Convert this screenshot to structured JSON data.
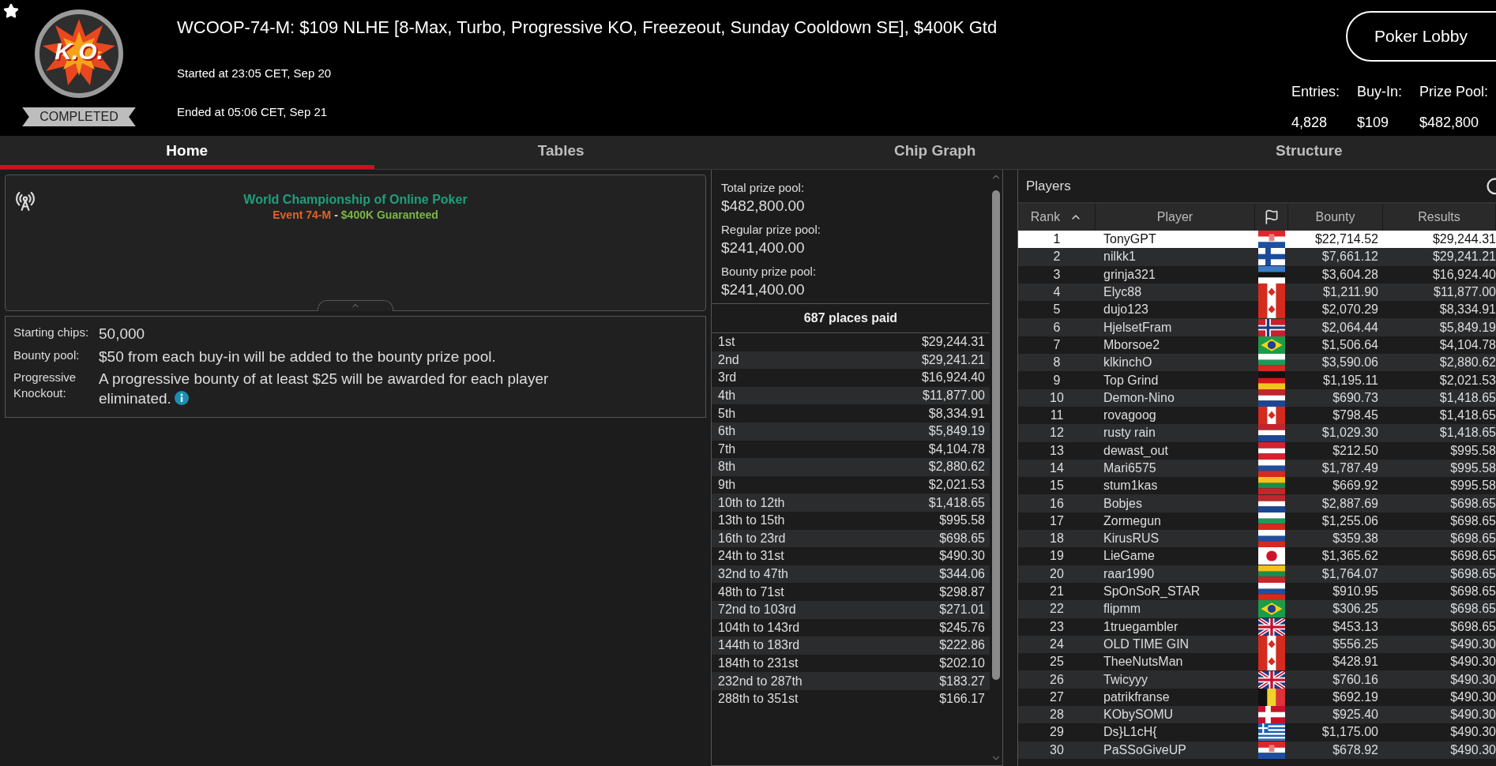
{
  "header": {
    "logo_text": "K.O.",
    "status": "COMPLETED",
    "title": "WCOOP-74-M: $109 NLHE [8-Max, Turbo, Progressive KO, Freezeout, Sunday Cooldown SE], $400K Gtd",
    "started": "Started at 23:05 CET, Sep 20",
    "ended": "Ended at 05:06 CET, Sep 21",
    "lobby_button": "Poker Lobby",
    "stats": [
      {
        "label": "Entries:",
        "value": "4,828"
      },
      {
        "label": "Buy-In:",
        "value": "$109"
      },
      {
        "label": "Prize Pool:",
        "value": "$482,800"
      }
    ]
  },
  "tabs": [
    {
      "label": "Home",
      "selected": true
    },
    {
      "label": "Tables",
      "selected": false
    },
    {
      "label": "Chip Graph",
      "selected": false
    },
    {
      "label": "Structure",
      "selected": false
    }
  ],
  "banner": {
    "title": "World Championship of Online Poker",
    "event": "Event 74-M",
    "separator": "-",
    "guarantee": "$400K Guaranteed"
  },
  "details": [
    {
      "label": "Starting chips:",
      "value": "50,000",
      "info": false
    },
    {
      "label": "Bounty pool:",
      "value": "$50 from each buy-in will be added to the bounty prize pool.",
      "info": false
    },
    {
      "label": "Progressive Knockout:",
      "value": "A progressive bounty of at least $25 will be awarded for each player eliminated.",
      "info": true
    }
  ],
  "prize_summary": [
    {
      "label": "Total prize pool:",
      "value": "$482,800.00"
    },
    {
      "label": "Regular prize pool:",
      "value": "$241,400.00"
    },
    {
      "label": "Bounty prize pool:",
      "value": "$241,400.00"
    }
  ],
  "places_paid": "687 places paid",
  "payouts": [
    {
      "place": "1st",
      "amount": "$29,244.31"
    },
    {
      "place": "2nd",
      "amount": "$29,241.21"
    },
    {
      "place": "3rd",
      "amount": "$16,924.40"
    },
    {
      "place": "4th",
      "amount": "$11,877.00"
    },
    {
      "place": "5th",
      "amount": "$8,334.91"
    },
    {
      "place": "6th",
      "amount": "$5,849.19"
    },
    {
      "place": "7th",
      "amount": "$4,104.78"
    },
    {
      "place": "8th",
      "amount": "$2,880.62"
    },
    {
      "place": "9th",
      "amount": "$2,021.53"
    },
    {
      "place": "10th to 12th",
      "amount": "$1,418.65"
    },
    {
      "place": "13th to 15th",
      "amount": "$995.58"
    },
    {
      "place": "16th to 23rd",
      "amount": "$698.65"
    },
    {
      "place": "24th to 31st",
      "amount": "$490.30"
    },
    {
      "place": "32nd to 47th",
      "amount": "$344.06"
    },
    {
      "place": "48th to 71st",
      "amount": "$298.87"
    },
    {
      "place": "72nd to 103rd",
      "amount": "$271.01"
    },
    {
      "place": "104th to 143rd",
      "amount": "$245.76"
    },
    {
      "place": "144th to 183rd",
      "amount": "$222.86"
    },
    {
      "place": "184th to 231st",
      "amount": "$202.10"
    },
    {
      "place": "232nd to 287th",
      "amount": "$183.27"
    },
    {
      "place": "288th to 351st",
      "amount": "$166.17"
    }
  ],
  "players": {
    "title": "Players",
    "columns": [
      {
        "kind": "text",
        "label": "Rank",
        "sorted": true
      },
      {
        "kind": "text",
        "label": "Player",
        "sorted": false
      },
      {
        "kind": "flag",
        "sorted": false
      },
      {
        "kind": "text",
        "label": "Bounty",
        "sorted": false
      },
      {
        "kind": "text",
        "label": "Results",
        "sorted": false
      }
    ],
    "rows": [
      {
        "rank": "1",
        "name": "TonyGPT",
        "kind": "hr",
        "bounty": "$22,714.52",
        "result": "$29,244.31",
        "selected": true
      },
      {
        "rank": "2",
        "name": "nilkk1",
        "kind": "fi",
        "bounty": "$7,661.12",
        "result": "$29,241.21",
        "selected": false
      },
      {
        "rank": "3",
        "name": "grinja321",
        "kind": "ee",
        "bounty": "$3,604.28",
        "result": "$16,924.40",
        "selected": false
      },
      {
        "rank": "4",
        "name": "Elyc88",
        "kind": "ca",
        "bounty": "$1,211.90",
        "result": "$11,877.00",
        "selected": false
      },
      {
        "rank": "5",
        "name": "dujo123",
        "kind": "ca",
        "bounty": "$2,070.29",
        "result": "$8,334.91",
        "selected": false
      },
      {
        "rank": "6",
        "name": "HjelsetFram",
        "kind": "no",
        "bounty": "$2,064.44",
        "result": "$5,849.19",
        "selected": false
      },
      {
        "rank": "7",
        "name": "Mborsoe2",
        "kind": "br",
        "bounty": "$1,506.64",
        "result": "$4,104.78",
        "selected": false
      },
      {
        "rank": "8",
        "name": "klkinchO",
        "kind": "bg",
        "bounty": "$3,590.06",
        "result": "$2,880.62",
        "selected": false
      },
      {
        "rank": "9",
        "name": "Top Grind",
        "kind": "de",
        "bounty": "$1,195.11",
        "result": "$2,021.53",
        "selected": false
      },
      {
        "rank": "10",
        "name": "Demon-Nino",
        "kind": "nl",
        "bounty": "$690.73",
        "result": "$1,418.65",
        "selected": false
      },
      {
        "rank": "11",
        "name": "rovagoog",
        "kind": "ca",
        "bounty": "$798.45",
        "result": "$1,418.65",
        "selected": false
      },
      {
        "rank": "12",
        "name": "rusty rain",
        "kind": "nl",
        "bounty": "$1,029.30",
        "result": "$1,418.65",
        "selected": false
      },
      {
        "rank": "13",
        "name": "dewast_out",
        "kind": "at",
        "bounty": "$212.50",
        "result": "$995.58",
        "selected": false
      },
      {
        "rank": "14",
        "name": "Mari6575",
        "kind": "ru",
        "bounty": "$1,787.49",
        "result": "$995.58",
        "selected": false
      },
      {
        "rank": "15",
        "name": "stum1kas",
        "kind": "lt",
        "bounty": "$669.92",
        "result": "$995.58",
        "selected": false
      },
      {
        "rank": "16",
        "name": "Bobjes",
        "kind": "nl",
        "bounty": "$2,887.69",
        "result": "$698.65",
        "selected": false
      },
      {
        "rank": "17",
        "name": "Zormegun",
        "kind": "bg",
        "bounty": "$1,255.06",
        "result": "$698.65",
        "selected": false
      },
      {
        "rank": "18",
        "name": "KirusRUS",
        "kind": "ru",
        "bounty": "$359.38",
        "result": "$698.65",
        "selected": false
      },
      {
        "rank": "19",
        "name": "LieGame",
        "kind": "jp",
        "bounty": "$1,365.62",
        "result": "$698.65",
        "selected": false
      },
      {
        "rank": "20",
        "name": "raar1990",
        "kind": "lt",
        "bounty": "$1,764.07",
        "result": "$698.65",
        "selected": false
      },
      {
        "rank": "21",
        "name": "SpOnSoR_STAR",
        "kind": "ru",
        "bounty": "$910.95",
        "result": "$698.65",
        "selected": false
      },
      {
        "rank": "22",
        "name": "flipmm",
        "kind": "br",
        "bounty": "$306.25",
        "result": "$698.65",
        "selected": false
      },
      {
        "rank": "23",
        "name": "1truegambler",
        "kind": "gb",
        "bounty": "$453.13",
        "result": "$698.65",
        "selected": false
      },
      {
        "rank": "24",
        "name": "OLD TIME GIN",
        "kind": "ca",
        "bounty": "$556.25",
        "result": "$490.30",
        "selected": false
      },
      {
        "rank": "25",
        "name": "TheeNutsMan",
        "kind": "ca",
        "bounty": "$428.91",
        "result": "$490.30",
        "selected": false
      },
      {
        "rank": "26",
        "name": "Twicyyy",
        "kind": "gb",
        "bounty": "$760.16",
        "result": "$490.30",
        "selected": false
      },
      {
        "rank": "27",
        "name": "patrikfranse",
        "kind": "be",
        "bounty": "$692.19",
        "result": "$490.30",
        "selected": false
      },
      {
        "rank": "28",
        "name": "KObySOMU",
        "kind": "dk",
        "bounty": "$925.40",
        "result": "$490.30",
        "selected": false
      },
      {
        "rank": "29",
        "name": "Ds}L1cH{",
        "kind": "gr",
        "bounty": "$1,175.00",
        "result": "$490.30",
        "selected": false
      },
      {
        "rank": "30",
        "name": "PaSSoGiveUP",
        "kind": "hr",
        "bounty": "$678.92",
        "result": "$490.30",
        "selected": false
      }
    ]
  }
}
